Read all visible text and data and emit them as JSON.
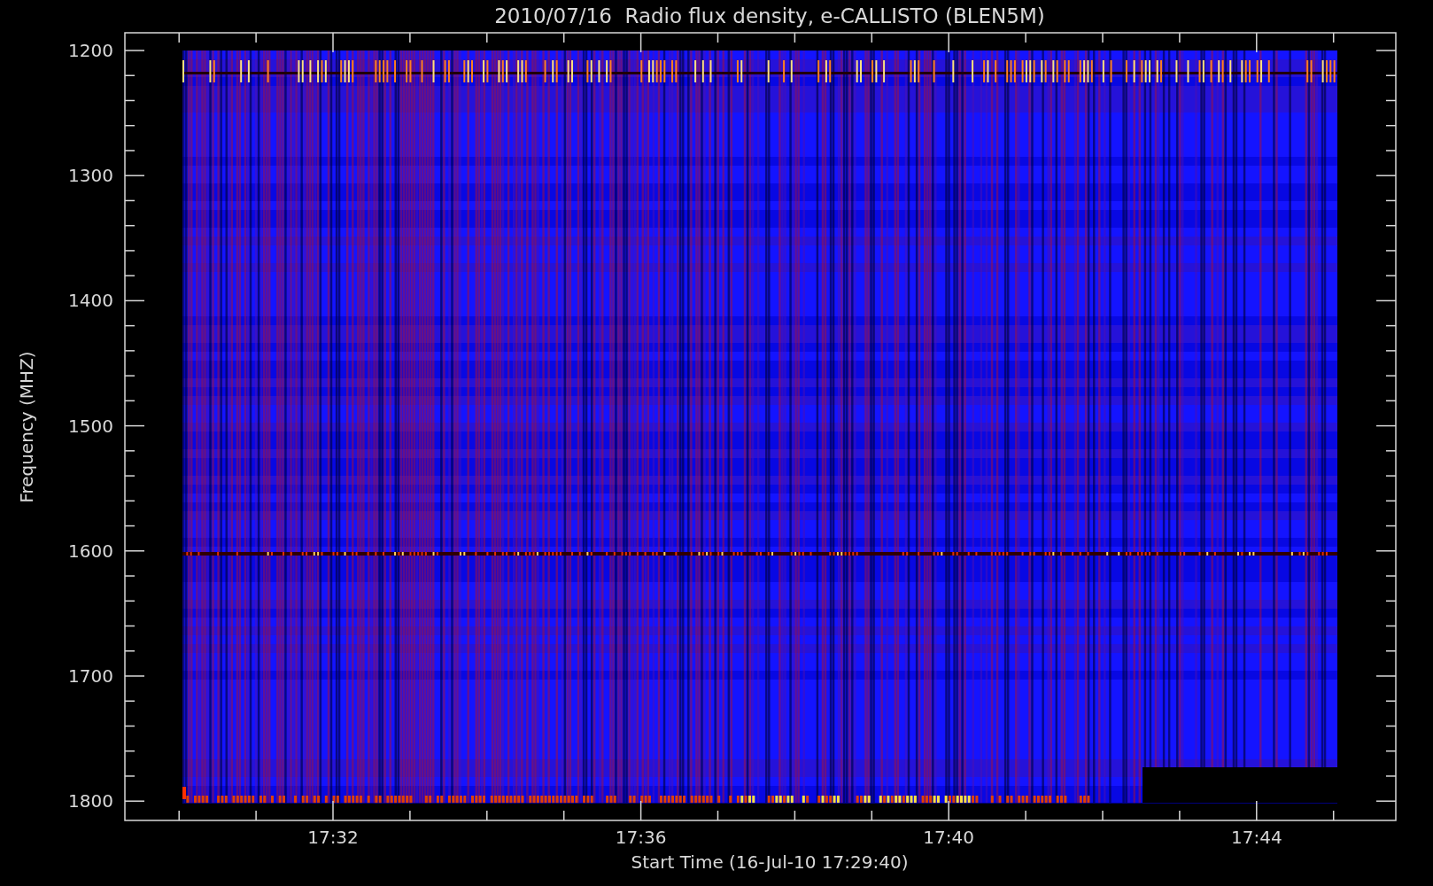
{
  "title": "2010/07/16  Radio flux density, e-CALLISTO (BLEN5M)",
  "y_axis": {
    "label": "Frequency (MHZ)",
    "ticks": [
      "1200",
      "1300",
      "1400",
      "1500",
      "1600",
      "1700",
      "1800"
    ]
  },
  "x_axis": {
    "label": "Start Time (16-Jul-10 17:29:40)",
    "ticks": [
      "17:32",
      "17:36",
      "17:40",
      "17:44"
    ]
  }
}
